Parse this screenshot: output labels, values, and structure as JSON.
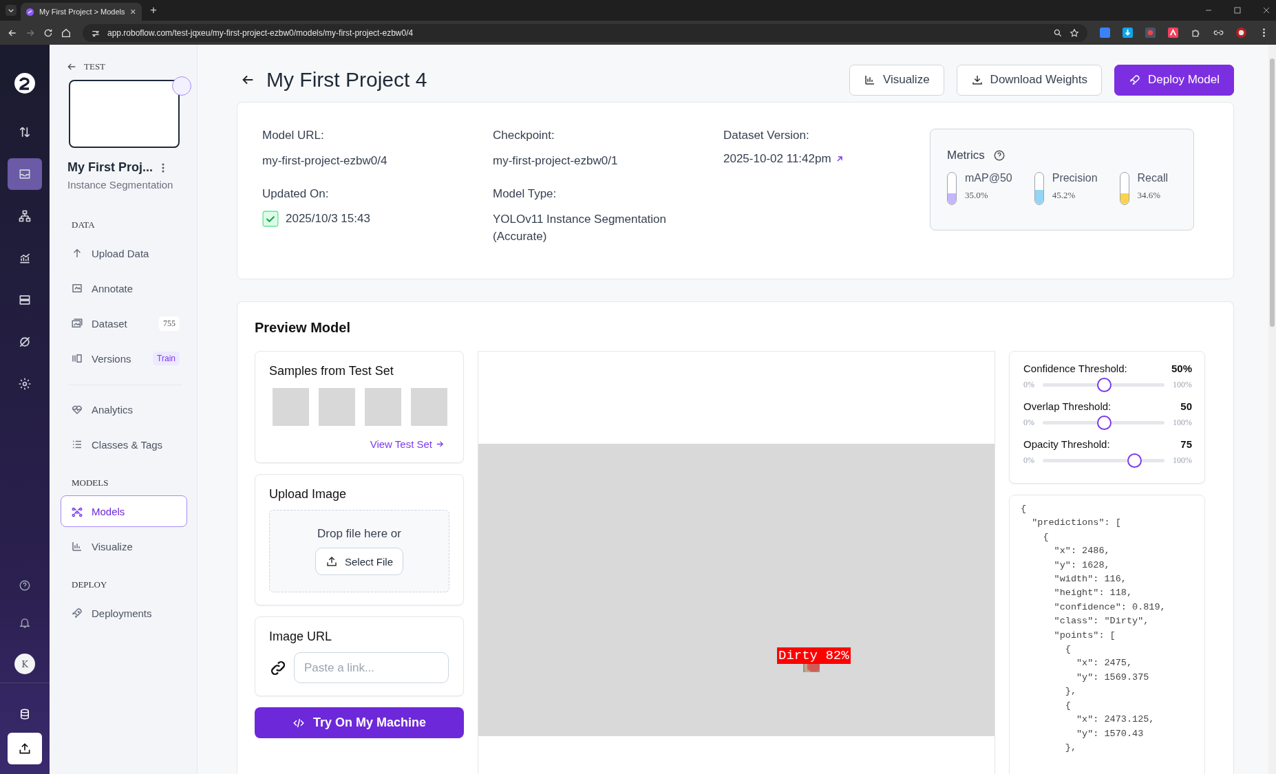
{
  "browser": {
    "tab_title": "My First Project > Models",
    "new_tab": "+",
    "url": "app.roboflow.com/test-jqxeu/my-first-project-ezbw0/models/my-first-project-ezbw0/4"
  },
  "rail": {
    "items": [
      {
        "selected": false
      },
      {
        "selected": true
      },
      {
        "selected": false
      },
      {
        "selected": false
      },
      {
        "selected": false
      },
      {
        "selected": false
      },
      {
        "selected": false
      }
    ],
    "avatar": "K"
  },
  "sidebar": {
    "back_label": "TEST",
    "project_name": "My First Proj...",
    "project_type": "Instance Segmentation",
    "sections": [
      {
        "title": "DATA",
        "items": [
          {
            "label": "Upload Data",
            "selected": false
          },
          {
            "label": "Annotate",
            "selected": false
          },
          {
            "label": "Dataset",
            "selected": false,
            "badge": {
              "text": "755",
              "kind": "count"
            }
          },
          {
            "label": "Versions",
            "selected": false,
            "badge": {
              "text": "Train",
              "kind": "tag"
            }
          }
        ]
      },
      {
        "items": [
          {
            "label": "Analytics",
            "selected": false
          },
          {
            "label": "Classes & Tags",
            "selected": false
          }
        ]
      },
      {
        "title": "MODELS",
        "items": [
          {
            "label": "Models",
            "selected": true
          },
          {
            "label": "Visualize",
            "selected": false
          }
        ]
      },
      {
        "title": "DEPLOY",
        "items": [
          {
            "label": "Deployments",
            "selected": false
          }
        ]
      }
    ]
  },
  "header": {
    "title": "My First Project 4",
    "buttons": [
      {
        "label": "Visualize",
        "kind": "outline"
      },
      {
        "label": "Download Weights",
        "kind": "outline"
      },
      {
        "label": "Deploy Model",
        "kind": "primary"
      }
    ]
  },
  "info": {
    "fields": [
      {
        "label": "Model URL:",
        "value": "my-first-project-ezbw0/4",
        "kind": "text"
      },
      {
        "label": "Checkpoint:",
        "value": "my-first-project-ezbw0/1",
        "kind": "text"
      },
      {
        "label": "Dataset Version:",
        "value": "2025-10-02 11:42pm",
        "kind": "link"
      },
      {
        "label": "Updated On:",
        "value": "2025/10/3 15:43",
        "kind": "checked"
      },
      {
        "label": "Model Type:",
        "value": "YOLOv11 Instance Segmentation (Accurate)",
        "kind": "text"
      }
    ],
    "metrics": {
      "title": "Metrics",
      "items": [
        {
          "name": "mAP@50",
          "reading": "35.0%",
          "level": 0.35,
          "color": "#c4b5fd"
        },
        {
          "name": "Precision",
          "reading": "45.2%",
          "level": 0.452,
          "color": "#93d5f5"
        },
        {
          "name": "Recall",
          "reading": "34.6%",
          "level": 0.346,
          "color": "#fcd34d"
        }
      ]
    }
  },
  "preview": {
    "title": "Preview Model",
    "samples": {
      "title": "Samples from Test Set",
      "link": "View Test Set"
    },
    "upload": {
      "title": "Upload Image",
      "drop_text": "Drop file here or",
      "button": "Select File"
    },
    "image_url": {
      "title": "Image URL",
      "placeholder": "Paste a link..."
    },
    "try_button": "Try On My Machine",
    "detection": {
      "label": "Dirty 82%"
    },
    "sliders": [
      {
        "label": "Confidence Threshold:",
        "reading": "50%",
        "min_label": "0%",
        "max_label": "100%",
        "level": 0.5
      },
      {
        "label": "Overlap Threshold:",
        "reading": "50",
        "min_label": "0%",
        "max_label": "100%",
        "level": 0.5
      },
      {
        "label": "Opacity Threshold:",
        "reading": "75",
        "min_label": "0%",
        "max_label": "100%",
        "level": 0.75
      }
    ],
    "output_lines": [
      "{",
      "  \"predictions\": [",
      "    {",
      "      \"x\": 2486,",
      "      \"y\": 1628,",
      "      \"width\": 116,",
      "      \"height\": 118,",
      "      \"confidence\": 0.819,",
      "      \"class\": \"Dirty\",",
      "      \"points\": [",
      "        {",
      "          \"x\": 2475,",
      "          \"y\": 1569.375",
      "        },",
      "        {",
      "          \"x\": 2473.125,",
      "          \"y\": 1570.43",
      "        },"
    ]
  }
}
